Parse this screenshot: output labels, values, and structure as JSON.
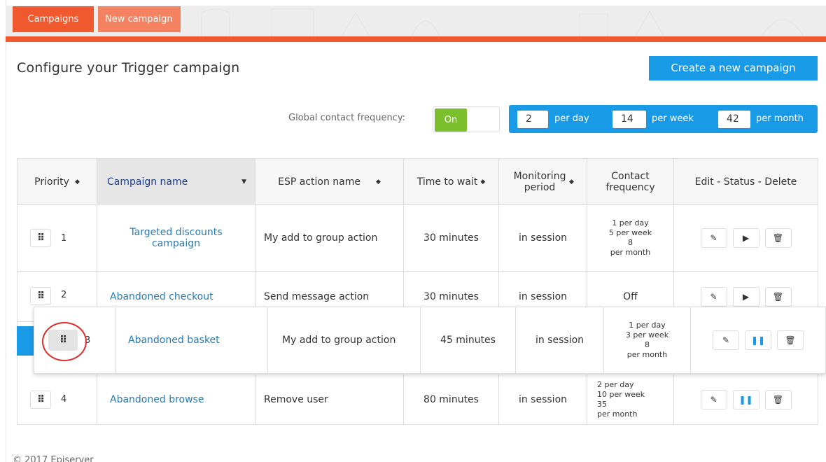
{
  "tabs": [
    {
      "label": "Campaigns"
    },
    {
      "label": "New campaign"
    }
  ],
  "header": {
    "title": "Configure your Trigger campaign",
    "create_button": "Create a new campaign"
  },
  "frequency": {
    "label": "Global contact frequency:",
    "toggle_state": "On",
    "per_day_value": "2",
    "per_day_label": "per day",
    "per_week_value": "14",
    "per_week_label": "per week",
    "per_month_value": "42",
    "per_month_label": "per month"
  },
  "table": {
    "columns": [
      {
        "label": "Priority"
      },
      {
        "label": "Campaign name"
      },
      {
        "label": "ESP action name"
      },
      {
        "label": "Time to wait"
      },
      {
        "label": "Monitoring period"
      },
      {
        "label": "Contact frequency"
      },
      {
        "label": "Edit - Status - Delete"
      }
    ],
    "rows": [
      {
        "priority": "1",
        "name": "Targeted discounts campaign",
        "action": "My add to group action",
        "wait": "30 minutes",
        "period": "in session",
        "freq": [
          "1 per day",
          "5 per week",
          "8",
          "per month"
        ],
        "status": "play"
      },
      {
        "priority": "2",
        "name": "Abandoned checkout",
        "action": "Send message action",
        "wait": "30 minutes",
        "period": "in session",
        "freq": [
          "Off"
        ],
        "status": "play"
      },
      {
        "priority": "3",
        "name": "Abandoned basket",
        "action": "My add to group action",
        "wait": "45 minutes",
        "period": "in session",
        "freq": [
          "1 per day",
          "3 per week",
          "8",
          "per month"
        ],
        "status": "pause"
      },
      {
        "priority": "4",
        "name": "Abandoned browse",
        "action": "Remove user",
        "wait": "80 minutes",
        "period": "in session",
        "freq": [
          "2 per day",
          "10 per week",
          "35",
          "per month"
        ],
        "status": "pause"
      }
    ]
  },
  "footer": {
    "text": "© 2017 Episerver"
  },
  "colors": {
    "accent_orange": "#f0582d",
    "accent_blue": "#199ae6",
    "toggle_green": "#7bbf2c",
    "highlight_red": "#e02b2b"
  },
  "icons": {
    "drag_handle": "drag-handle-icon",
    "edit": "pencil-icon",
    "play": "play-icon",
    "pause": "pause-icon",
    "delete": "trash-icon",
    "sort": "sort-icon",
    "sort_desc": "caret-down-icon"
  }
}
